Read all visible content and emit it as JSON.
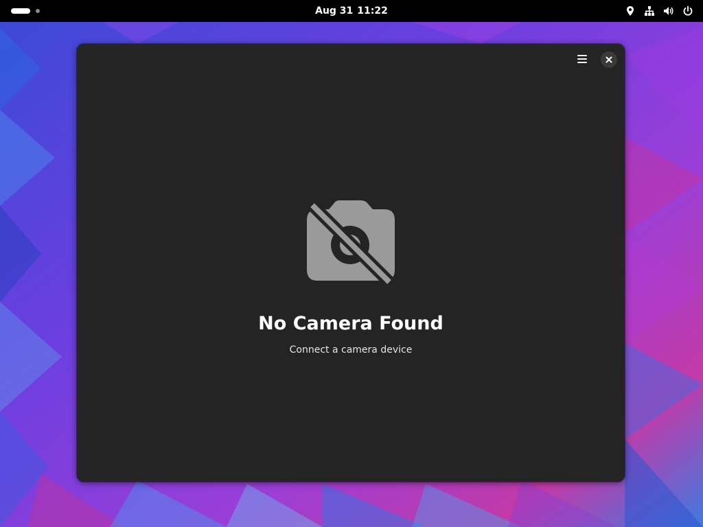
{
  "topbar": {
    "date": "Aug 31",
    "time": "11:22",
    "status_icons": [
      "location-icon",
      "network-icon",
      "volume-icon",
      "power-icon"
    ]
  },
  "window": {
    "status_icon": "camera-disabled-icon",
    "title": "No Camera Found",
    "description": "Connect a camera device",
    "header_icons": [
      "hamburger-menu-icon",
      "close-icon"
    ]
  },
  "colors": {
    "window_bg": "#242424",
    "topbar_bg": "#000000",
    "icon_gray": "#9a9a9a",
    "title_text": "#ffffff"
  }
}
